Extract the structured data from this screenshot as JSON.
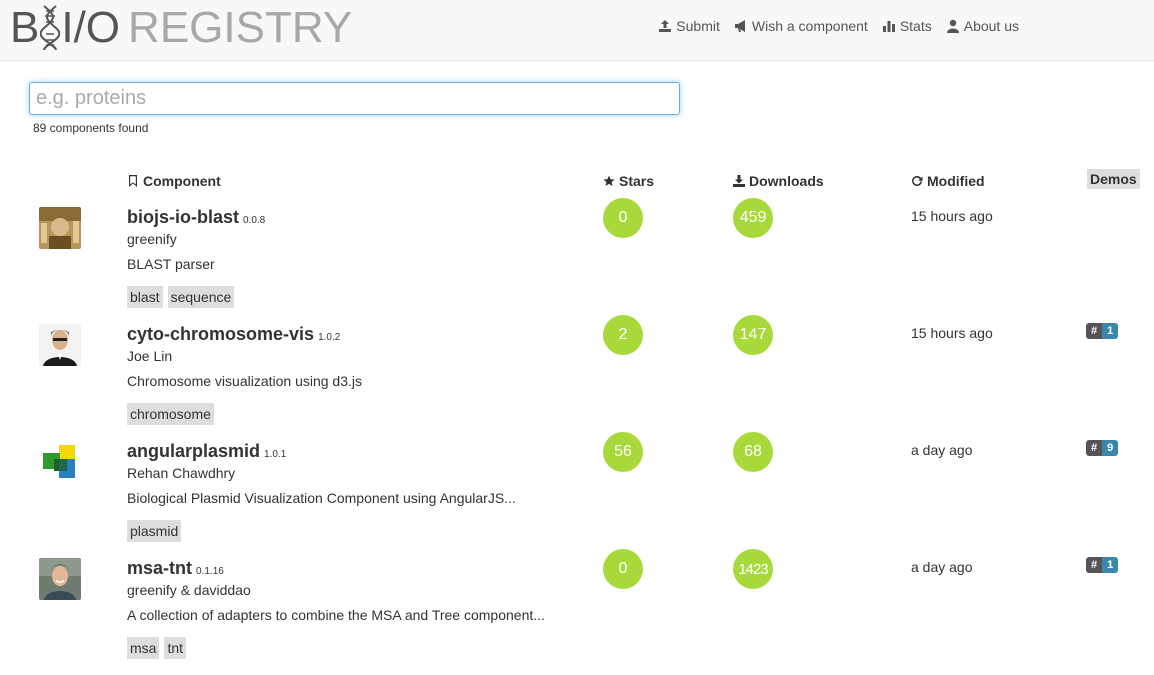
{
  "header": {
    "logo_b": "B",
    "logo_io": "I/O",
    "logo_registry": "REGISTRY",
    "nav": [
      {
        "label": "Submit",
        "icon": "upload-icon"
      },
      {
        "label": "Wish a component",
        "icon": "bullhorn-icon"
      },
      {
        "label": "Stats",
        "icon": "stats-icon"
      },
      {
        "label": "About us",
        "icon": "user-icon"
      }
    ]
  },
  "search": {
    "placeholder": "e.g. proteins",
    "value": "",
    "results_count": "89 components found"
  },
  "columns": {
    "component": "Component",
    "stars": "Stars",
    "downloads": "Downloads",
    "modified": "Modified",
    "demos": "Demos"
  },
  "rows": [
    {
      "name": "biojs-io-blast",
      "version": "0.0.8",
      "author": "greenify",
      "description": "BLAST parser",
      "tags": [
        "blast",
        "sequence"
      ],
      "stars": "0",
      "downloads": "459",
      "modified": "15 hours ago",
      "demos": ""
    },
    {
      "name": "cyto-chromosome-vis",
      "version": "1.0.2",
      "author": "Joe Lin",
      "description": "Chromosome visualization using d3.js",
      "tags": [
        "chromosome"
      ],
      "stars": "2",
      "downloads": "147",
      "modified": "15 hours ago",
      "demos": "1"
    },
    {
      "name": "angularplasmid",
      "version": "1.0.1",
      "author": "Rehan Chawdhry",
      "description": "Biological Plasmid Visualization Component using AngularJS...",
      "tags": [
        "plasmid"
      ],
      "stars": "56",
      "downloads": "68",
      "modified": "a day ago",
      "demos": "9"
    },
    {
      "name": "msa-tnt",
      "version": "0.1.16",
      "author": "greenify & daviddao",
      "description": "A collection of adapters to combine the MSA and Tree component...",
      "tags": [
        "msa",
        "tnt"
      ],
      "stars": "0",
      "downloads": "1423",
      "modified": "a day ago",
      "demos": "1"
    }
  ],
  "demo_hash": "#",
  "colors": {
    "accent_green": "#a8d93a",
    "demo_blue": "#3a87ad",
    "demo_dark": "#555555"
  }
}
